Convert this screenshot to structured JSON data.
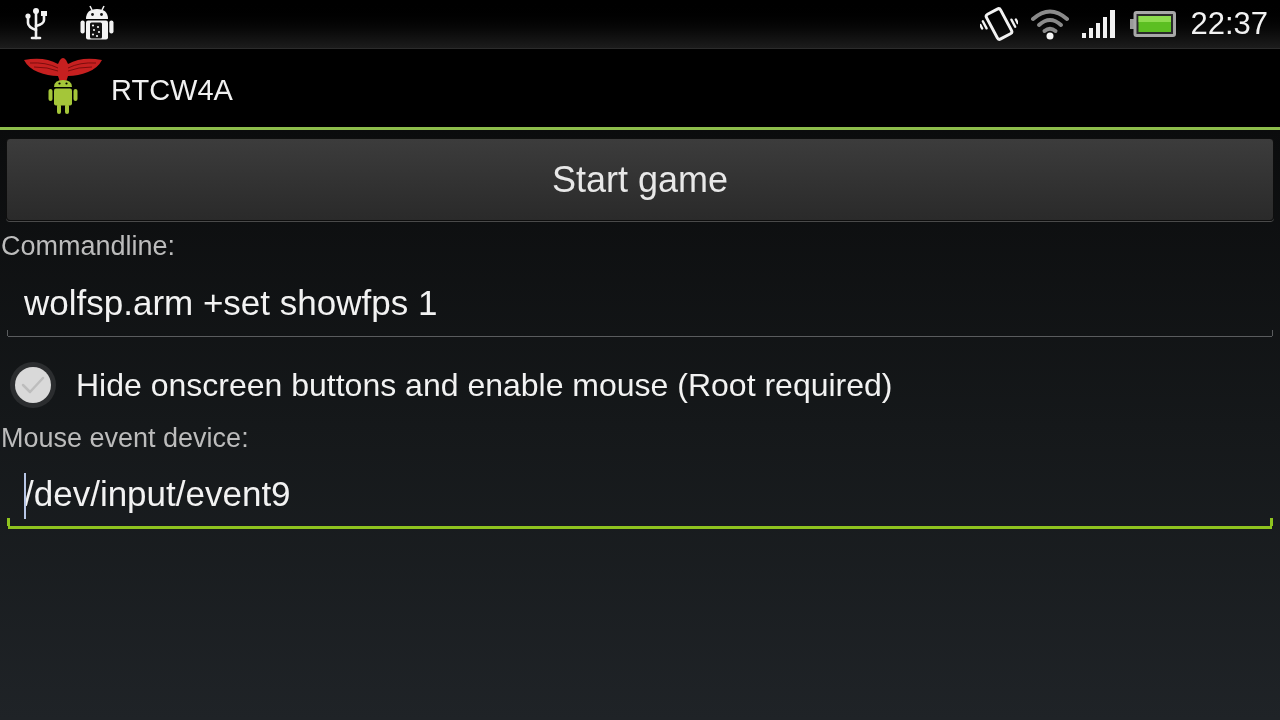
{
  "status_bar": {
    "time": "22:37"
  },
  "action_bar": {
    "title": "RTCW4A"
  },
  "start_button": {
    "label": "Start game"
  },
  "form": [
    {
      "kind": "field",
      "label": "Commandline:",
      "value": "wolfsp.arm +set showfps 1",
      "focused": false
    },
    {
      "kind": "checkbox",
      "label": "Hide onscreen buttons and enable mouse (Root required)",
      "checked": false
    },
    {
      "kind": "field",
      "label": "Mouse event device:",
      "value": "/dev/input/event9",
      "focused": true
    }
  ]
}
